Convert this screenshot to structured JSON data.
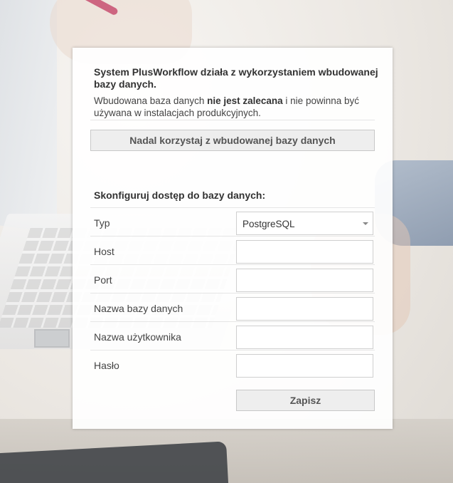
{
  "notice": {
    "heading": "System PlusWorkflow działa z wykorzystaniem wbudowanej bazy danych.",
    "desc_part1": "Wbudowana baza danych ",
    "desc_bold": "nie jest zalecana",
    "desc_part2": " i nie powinna być używana w instalacjach produkcyjnych.",
    "keep_embedded_button": "Nadal korzystaj z wbudowanej bazy danych"
  },
  "db_config": {
    "section_title": "Skonfiguruj dostęp do bazy danych:",
    "fields": [
      {
        "label": "Typ",
        "kind": "select",
        "value": "PostgreSQL"
      },
      {
        "label": "Host",
        "kind": "text",
        "value": ""
      },
      {
        "label": "Port",
        "kind": "text",
        "value": ""
      },
      {
        "label": "Nazwa bazy danych",
        "kind": "text",
        "value": ""
      },
      {
        "label": "Nazwa użytkownika",
        "kind": "text",
        "value": ""
      },
      {
        "label": "Hasło",
        "kind": "password",
        "value": ""
      }
    ],
    "save_button": "Zapisz"
  },
  "icons": {
    "select_caret": "chevron-down-icon"
  }
}
